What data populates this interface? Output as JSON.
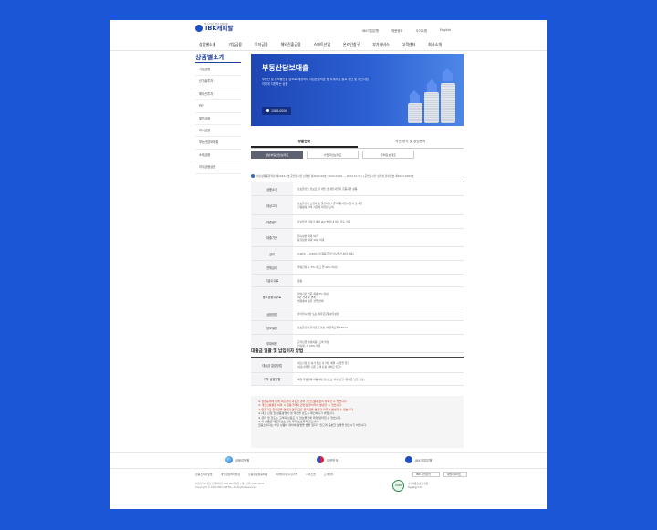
{
  "header": {
    "logo_sub": "중소기업을 위한 종합금융",
    "logo_text": "IBK캐피탈",
    "utility": [
      "IBK기업은행",
      "채용정보",
      "사이트맵",
      "English"
    ],
    "gnb": [
      "상품별소개",
      "기업금융",
      "투자금융",
      "해외진출금융",
      "스마트산업",
      "온라인창구",
      "부가서비스",
      "고객센터",
      "회사소개"
    ]
  },
  "lnb": {
    "title": "상품별소개",
    "items": [
      "기업금융",
      "신기술투자",
      "해외신투자",
      "PEF",
      "할부금융",
      "리스금융",
      "부동산담보대출",
      "소매금융",
      "이외금융상품"
    ]
  },
  "banner": {
    "title": "부동산담보대출",
    "desc": "부동산 및 담보물건을 담보로 제공하여 사업운영자금 등 자체자금 필요 개인 및 개인사업자에게 지원하는 상품",
    "phone": "1588-0000"
  },
  "tabs": [
    "상품안내",
    "약관/양식 및 상담문의"
  ],
  "subtabs": [
    "일반부동산담보대출",
    "사업자담보대출",
    "주택담보대출"
  ],
  "notice": "여신상품종합약관 제2023-1호 준법감시인 심의필 제2023-00호 (2024.01.01 ~ 2024.12.31) | 준법감시인 심의필 관리번호 제2023-0000호",
  "product_rows": [
    {
      "th": "상품소개",
      "td": "담보물건을 담보로 한 개인 및 개인사업자 금융지원 상품"
    },
    {
      "th": "대상고객",
      "td": "담보물건의 소유자 및 물건지역 거주자 중 개인사업자 및 개인\n신용평점 관리 기준에 적합한 고객"
    },
    {
      "th": "대출한도",
      "td": "담보물건 감정가 대비 LTV 범위 내 최대 한도 적용"
    },
    {
      "th": "대출기간",
      "td": "일시상환 최대 5년\n분할상환 최대 10년 이내"
    },
    {
      "th": "금리",
      "td": "5.00% ~ 9.50% (신용등급 및 담보물건 따라 차등)"
    },
    {
      "th": "연체금리",
      "td": "약정금리 + 3% (최고 연 20% 이내)"
    },
    {
      "th": "취급수수료",
      "td": "없음"
    },
    {
      "th": "중도상환수수료",
      "td": "잔여기간 기준 최대 2% 이내\n3년 경과 후 면제\n법령에서 정한 경우 면제"
    },
    {
      "th": "상환방법",
      "td": "만기일시상환 또는 원리금균등분할상환"
    },
    {
      "th": "담보설정",
      "td": "담보물건에 근저당권 설정 (채권최고액 120%)"
    },
    {
      "th": "부대비용",
      "td": "근저당권 설정비용: 고객 부담\n인지세: 각 50% 부담"
    }
  ],
  "section_title": "대출금 일괄 및 납입이자 방법",
  "settle_rows": [
    {
      "th": "대출금 일괄방법",
      "td": "대출신청 및 심사 완료 후 약정 체결 시 일괄 입금\n(대출실행일 기준 고객 지정 계좌로 입금)"
    },
    {
      "th": "이자 납입방법",
      "td": "매월 약정일에 자동이체 방식으로 이자 납입 (원리금 납입 포함)"
    }
  ],
  "warnings": [
    {
      "text": "※ 상환능력에 비해 대출금이 과도할 경우 개인신용평점이 하락할 수 있습니다.",
      "red": true
    },
    {
      "text": "※ 개인신용평점 하락 시 금융거래와 관련된 불이익이 발생할 수 있습니다.",
      "red": true
    },
    {
      "text": "※ 일정기간 원리금을 연체할 경우 모든 원리금을 변제할 의무가 발생할 수 있습니다.",
      "red": true
    },
    {
      "text": "※ 대출 신청 전 상품설명서 및 약관을 반드시 확인하시기 바랍니다.",
      "red": false
    },
    {
      "text": "※ 금리 및 한도는 고객의 신용도 및 담보물건에 따라 달라질 수 있습니다.",
      "red": false
    },
    {
      "text": "※ 이 상품은 예금자보호법에 따라 보호되지 않습니다.",
      "red": false
    },
    {
      "text": "금융소비자는 해당 상품에 대하여 설명을 받을 권리가 있으며 충분한 설명을 받으시기 바랍니다.",
      "red": false
    }
  ],
  "partners": [
    "금융감독원",
    "대한민국",
    "IBK기업은행"
  ],
  "footer": {
    "links": [
      "금융소비자보호",
      "개인정보처리방침",
      "신용정보활용체제",
      "이메일무단수집거부",
      "사이트맵",
      "고객센터"
    ],
    "select1": "IBK 기업은행",
    "select2": "패밀리사이트",
    "address": "서울특별시 강남구 테헤란로 000 IBK캐피탈 | 대표전화 1588-0000\nCopyright © 2024 IBK CAPITAL. All Rights Reserved.",
    "cert_badge": "CCM",
    "cert_text": "소비자중심경영 인증\nSynergy Ltd"
  }
}
